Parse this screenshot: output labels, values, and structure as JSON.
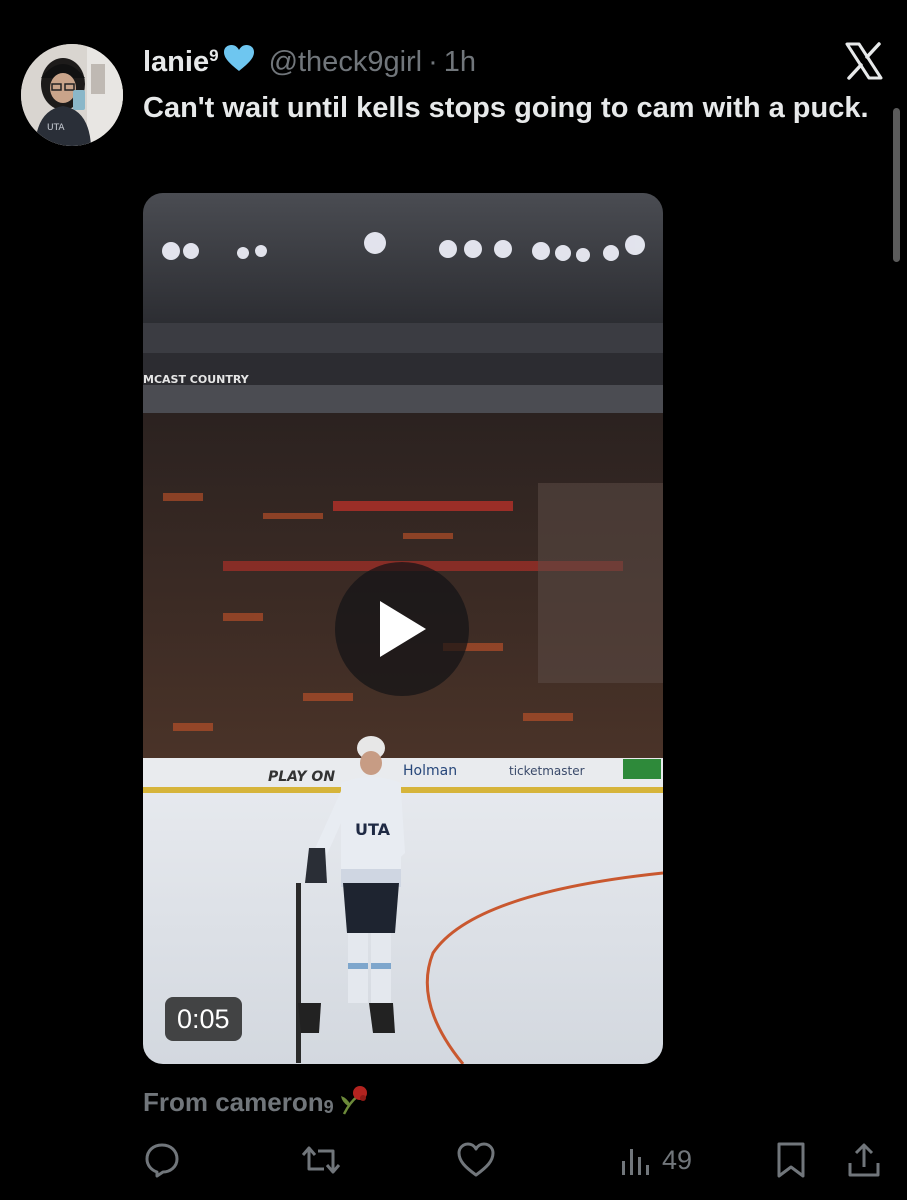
{
  "tweet": {
    "display_name": "lanie",
    "display_name_superscript": "9",
    "heart_emoji": "💙",
    "handle": "@theck9girl",
    "separator": "·",
    "time": "1h",
    "text": "Can't wait until kells stops going to cam with a puck."
  },
  "media": {
    "duration": "0:05",
    "arena_banner_text": "MCAST COUNTRY",
    "board_ads": [
      "PLAY ON",
      "Holman",
      "ticketmaster"
    ],
    "jersey_text": "UTA"
  },
  "source": {
    "prefix": "From cameron",
    "suffix": "9"
  },
  "actions": {
    "views": "49"
  },
  "icons": {
    "x_logo": "x-logo-icon",
    "reply": "reply-icon",
    "repost": "repost-icon",
    "like": "heart-icon",
    "views": "bar-chart-icon",
    "bookmark": "bookmark-icon",
    "share": "share-icon",
    "play": "play-icon",
    "rose": "wilted-rose-icon"
  },
  "colors": {
    "background": "#000000",
    "text_primary": "#e7e9ea",
    "text_secondary": "#71767b",
    "heart": "#6ec6f0"
  }
}
